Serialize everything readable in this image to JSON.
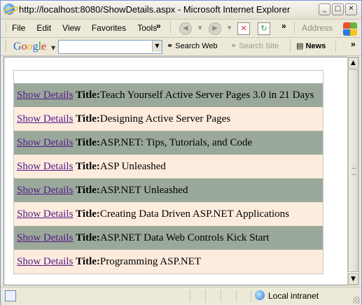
{
  "window": {
    "title": "http://localhost:8080/ShowDetails.aspx - Microsoft Internet Explorer",
    "controls": {
      "minimize": "_",
      "maximize": "□",
      "close": "✕"
    }
  },
  "menubar": {
    "items": [
      "File",
      "Edit",
      "View",
      "Favorites",
      "Tools"
    ],
    "overflow": "»",
    "address_label": "Address"
  },
  "google_toolbar": {
    "logo": "Google",
    "search_value": "",
    "buttons": {
      "search_web": "Search Web",
      "search_site": "Search Site",
      "news": "News"
    },
    "overflow": "»"
  },
  "page": {
    "link_label": "Show Details",
    "title_label": "Title:",
    "items": [
      "Teach Yourself Active Server Pages 3.0 in 21 Days",
      "Designing Active Server Pages",
      "ASP.NET: Tips, Tutorials, and Code",
      "ASP Unleashed",
      "ASP.NET Unleashed",
      "Creating Data Driven ASP.NET Applications",
      "ASP.NET Data Web Controls Kick Start",
      "Programming ASP.NET"
    ],
    "colors": {
      "alt_row": "#9aa99a",
      "plain_row": "#fdebdd",
      "link": "#551a8b"
    }
  },
  "statusbar": {
    "zone": "Local intranet"
  }
}
